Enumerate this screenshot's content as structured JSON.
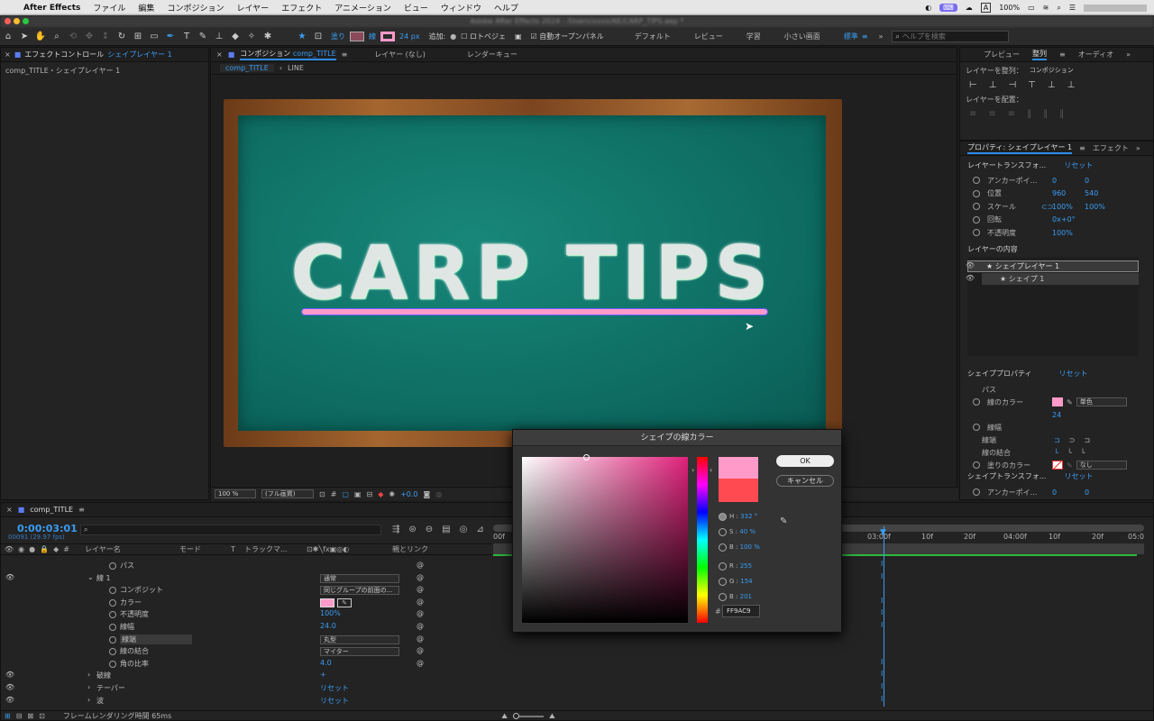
{
  "menubar": {
    "app": "After Effects",
    "items": [
      "ファイル",
      "編集",
      "コンポジション",
      "レイヤー",
      "エフェクト",
      "アニメーション",
      "ビュー",
      "ウィンドウ",
      "ヘルプ"
    ],
    "battery": "100%"
  },
  "window_title": "Adobe After Effects 2024 - /Users/xxxx/AE/CARP_TIPS.aep *",
  "toolbar": {
    "fill_label": "塗り",
    "stroke_label": "線",
    "stroke_px": "24 px",
    "add_label": "追加:",
    "bezier_label": "ロトベジェ",
    "auto_open_label": "自動オープンパネル",
    "workspaces": [
      "デフォルト",
      "レビュー",
      "学習",
      "小さい画面",
      "標準"
    ],
    "search_placeholder": "ヘルプを検索"
  },
  "effect_panel": {
    "tab": "エフェクトコントロール",
    "tab_layer": "シェイプレイヤー 1",
    "breadcrumb": "comp_TITLE・シェイプレイヤー 1"
  },
  "comp_panel": {
    "tab": "コンポジション",
    "tab_comp": "comp_TITLE",
    "tab_layer": "レイヤー (なし)",
    "tab_render": "レンダーキュー",
    "subtab1": "comp_TITLE",
    "subtab2": "LINE",
    "zoom": "100 %",
    "quality": "(フル画質)",
    "exposure": "+0.0",
    "canvas_text": "CARP TIPS"
  },
  "right_top": {
    "tabs": [
      "プレビュー",
      "整列",
      "オーディオ"
    ],
    "align_label": "レイヤーを整列：",
    "align_target": "コンポジション",
    "distribute_label": "レイヤーを配置："
  },
  "properties": {
    "tab": "プロパティ: シェイプレイヤー 1",
    "tab2": "エフェクト",
    "transform_label": "レイヤートランスフォ...",
    "reset": "リセット",
    "rows": [
      {
        "label": "アンカーポイ...",
        "v1": "0",
        "v2": "0"
      },
      {
        "label": "位置",
        "v1": "960",
        "v2": "540"
      },
      {
        "label": "スケール",
        "v1": "100%",
        "v2": "100%"
      },
      {
        "label": "回転",
        "v1": "0x+0°",
        "v2": ""
      },
      {
        "label": "不透明度",
        "v1": "100%",
        "v2": ""
      }
    ],
    "contents_label": "レイヤーの内容",
    "layer1": "シェイプレイヤー 1",
    "shape1": "シェイプ 1",
    "shape_props_label": "シェイププロパティ",
    "path": "パス",
    "stroke_color_label": "線のカラー",
    "stroke_type": "単色",
    "stroke_width_label": "線幅",
    "stroke_width": "24",
    "cap_label": "線端",
    "join_label": "線の結合",
    "fill_color_label": "塗りのカラー",
    "fill_type": "なし",
    "shape_transform_label": "シェイプトランスフォ...",
    "anchor2": "アンカーポイ...",
    "anchor2_v1": "0",
    "anchor2_v2": "0"
  },
  "timeline": {
    "tab": "comp_TITLE",
    "timecode": "0:00:03:01",
    "fps": "00091 (29.97 fps)",
    "cols": {
      "layer_name": "レイヤー名",
      "mode": "モード",
      "t": "T",
      "track": "トラックマ...",
      "parent": "親とリンク"
    },
    "ruler": [
      "00f",
      "03:00f",
      "10f",
      "20f",
      "04:00f",
      "10f",
      "20f",
      "05:0"
    ],
    "rows": [
      {
        "indent": 3,
        "name": "パス",
        "value": ""
      },
      {
        "indent": 2,
        "name": "線 1",
        "value": "通常"
      },
      {
        "indent": 3,
        "name": "コンポジット",
        "value": "同じグループの前面の..."
      },
      {
        "indent": 3,
        "name": "カラー",
        "value": ""
      },
      {
        "indent": 3,
        "name": "不透明度",
        "value": "100%"
      },
      {
        "indent": 3,
        "name": "線幅",
        "value": "24.0"
      },
      {
        "indent": 3,
        "name": "線端",
        "value": "丸型"
      },
      {
        "indent": 3,
        "name": "線の結合",
        "value": "マイター"
      },
      {
        "indent": 3,
        "name": "角の比率",
        "value": "4.0"
      },
      {
        "indent": 2,
        "name": "破線",
        "value": "+"
      },
      {
        "indent": 2,
        "name": "テーパー",
        "value": "リセット"
      },
      {
        "indent": 2,
        "name": "波",
        "value": "リセット"
      }
    ],
    "render_time": "フレームレンダリング時間 65ms"
  },
  "color_dialog": {
    "title": "シェイプの線カラー",
    "ok": "OK",
    "cancel": "キャンセル",
    "h": "332 °",
    "s": "40 %",
    "b": "100 %",
    "r": "255",
    "g": "154",
    "bv": "201",
    "hex": "FF9AC9",
    "current": "#FF9AC9",
    "previous": "#FF4A52"
  }
}
